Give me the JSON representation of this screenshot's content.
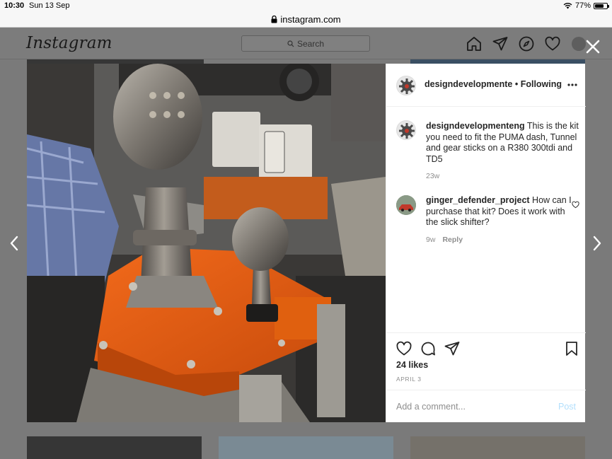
{
  "status_bar": {
    "time": "10:30",
    "date": "Sun 13 Sep",
    "battery": "77%",
    "battery_level": 0.77
  },
  "browser": {
    "url": "instagram.com"
  },
  "header": {
    "logo": "Instagram",
    "search_placeholder": "Search",
    "nav_icons": [
      "home-icon",
      "direct-icon",
      "explore-icon",
      "activity-heart-icon",
      "profile-avatar"
    ]
  },
  "post": {
    "author": "designdevelopmente",
    "separator": "•",
    "follow_status": "Following",
    "caption": {
      "username": "designdevelopmenteng",
      "text": " This is the kit you need to fit the PUMA dash, Tunnel and gear sticks on a R380 300tdi and TD5",
      "time": "23w"
    },
    "comments": [
      {
        "username": "ginger_defender_project",
        "text": " How can I purchase that kit? Does it work with the slick shifter?",
        "time": "9w",
        "reply_label": "Reply"
      }
    ],
    "likes": "24 likes",
    "date": "APRIL 3",
    "add_comment_placeholder": "Add a comment...",
    "post_button": "Post"
  },
  "colors": {
    "accent_disabled": "#b2dffc",
    "overlay": "#7a7a7a",
    "muted_text": "#8e8e8e"
  }
}
